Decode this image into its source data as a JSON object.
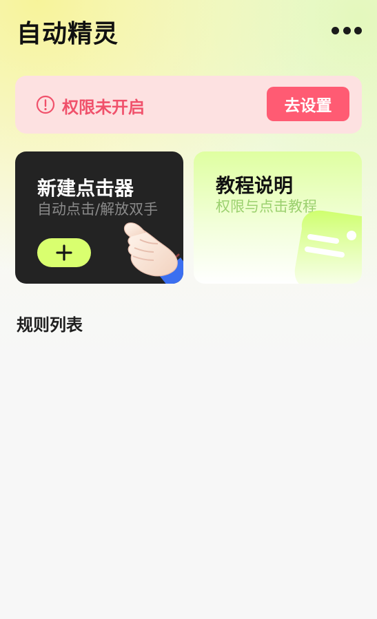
{
  "app": {
    "title": "自动精灵"
  },
  "header": {
    "more_icon": "more-horizontal-icon"
  },
  "permission_banner": {
    "message": "权限未开启",
    "button_label": "去设置",
    "icon": "warning-circle-icon",
    "colors": {
      "background": "#fde1e1",
      "text": "#f0516b",
      "button": "#ff5b73"
    }
  },
  "cards": {
    "new_clicker": {
      "title": "新建点击器",
      "subtitle": "自动点击/解放双手",
      "add_icon": "plus-icon",
      "illustration": "pointing-hand-icon",
      "colors": {
        "background": "#232323",
        "button": "#d9ff6f"
      }
    },
    "tutorial": {
      "title": "教程说明",
      "subtitle": "权限与点击教程",
      "illustration": "tutorial-face-icon",
      "colors": {
        "background": "#dfffa1",
        "subtitle": "#9bd06f"
      }
    }
  },
  "rules": {
    "section_title": "规则列表"
  }
}
